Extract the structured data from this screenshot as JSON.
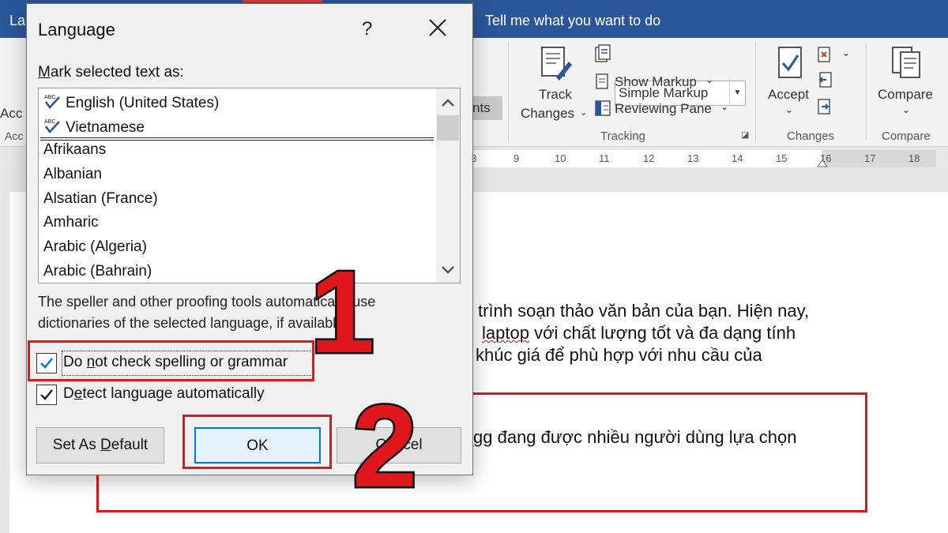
{
  "titlebar": {
    "tab_stub": "La",
    "tell_me": "Tell me what you want to do"
  },
  "ribbon": {
    "left_stub_top": "Acc",
    "left_stub_bottom": "Acc",
    "hidden_button_stub": "nts",
    "track_changes": [
      "Track",
      "Changes"
    ],
    "simple_markup": "Simple Markup",
    "show_markup": "Show Markup",
    "reviewing_pane": "Reviewing Pane",
    "tracking_group": "Tracking",
    "accept": "Accept",
    "changes_group": "Changes",
    "compare": "Compare",
    "compare_group": "Compare"
  },
  "ruler_ticks": [
    "8",
    "9",
    "10",
    "11",
    "12",
    "13",
    "14",
    "15",
    "16",
    "17",
    "18"
  ],
  "document": {
    "line1": "trình soạn thảo văn bản của bạn. Hiện nay,",
    "line2_squiggle": "laptop",
    "line2_rest": " với chất lượng tốt và đa dạng tính",
    "line3": "khúc giá để phù hợp với nhu cầu của",
    "line4_squiggle": "gg",
    "line4_rest": " đang được nhiều người dùng lựa chọn"
  },
  "annotations": {
    "step1": "1",
    "step2": "2"
  },
  "dialog": {
    "title": "Language",
    "help": "?",
    "mark_label_accel": "M",
    "mark_label_rest": "ark selected text as:",
    "languages_top": [
      "English (United States)",
      "Vietnamese"
    ],
    "languages": [
      "Afrikaans",
      "Albanian",
      "Alsatian (France)",
      "Amharic",
      "Arabic (Algeria)",
      "Arabic (Bahrain)"
    ],
    "note_line1": "The speller and other proofing tools automatically use",
    "note_line2": "dictionaries of the selected language, if available.",
    "no_check": {
      "before": "Do ",
      "accel": "n",
      "after": "ot check spelling or grammar",
      "checked": true
    },
    "detect": {
      "before": "D",
      "accel": "e",
      "after": "tect language automatically",
      "checked": true
    },
    "set_default": {
      "before": "Set As ",
      "accel": "D",
      "after": "efault"
    },
    "ok": "OK",
    "cancel": "Cancel"
  },
  "colors": {
    "accent": "#2b579a",
    "annotation_red": "#e0161d",
    "focus_blue": "#0078d7"
  }
}
